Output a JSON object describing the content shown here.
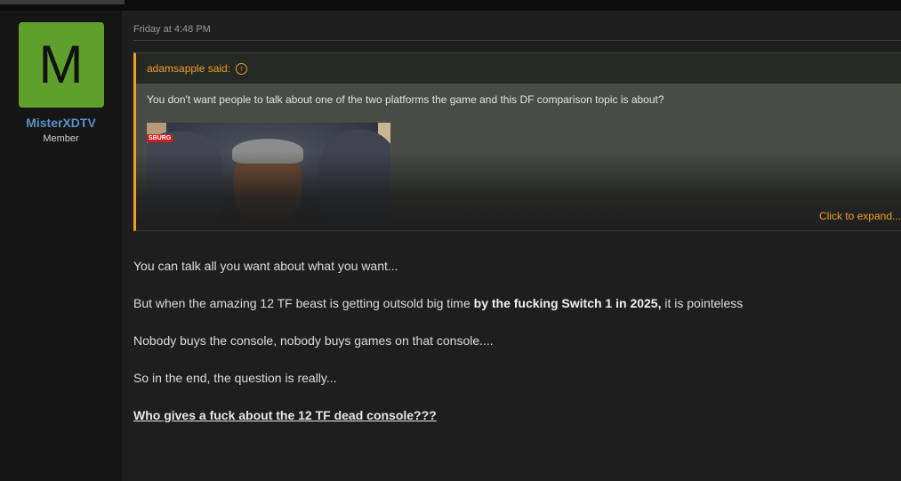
{
  "post": {
    "date": "Friday at 4:48 PM",
    "user": {
      "avatar_letter": "M",
      "avatar_color": "#5fa02c",
      "username": "MisterXDTV",
      "title": "Member"
    },
    "quote": {
      "author": "adamsapple said:",
      "author_icon": "arrow-up-circle-icon",
      "text": "You don't want people to talk about one of the two platforms the game and this DF comparison topic is about?",
      "image_tag": "SBURG",
      "expand_label": "Click to expand..."
    },
    "body": {
      "line1": "You can talk all you want about what you want...",
      "line2_pre": "But when the amazing 12 TF beast is getting outsold big time ",
      "line2_bold": "by the fucking Switch 1 in 2025,",
      "line2_post": " it is pointeless",
      "line3": "Nobody buys the console, nobody buys games on that console....",
      "line4": "So in the end, the question is really...",
      "line5_link": "Who gives a fuck about the 12 TF dead console???"
    }
  },
  "colors": {
    "accent": "#f0a020",
    "username": "#5b8fc7"
  }
}
